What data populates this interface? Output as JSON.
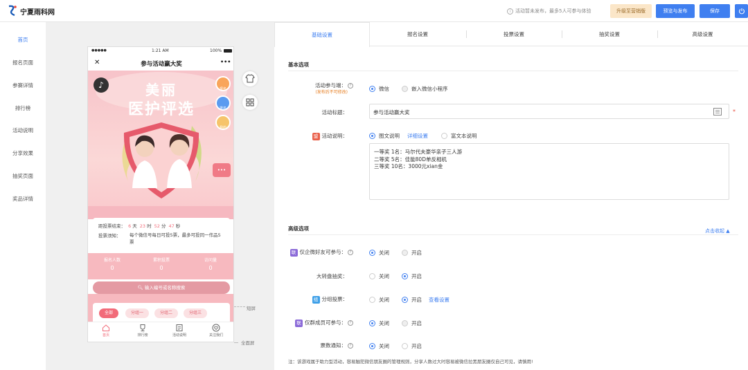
{
  "app": {
    "logo_text": "宁夏雨科网"
  },
  "topbar": {
    "notice": "活动暂未发布，最多5人可参与体验",
    "upgrade": "升级至营销版",
    "preview_publish": "预览与发布",
    "save": "保存"
  },
  "sidenav": {
    "items": [
      "首页",
      "报名页面",
      "参赛详情",
      "排行榜",
      "活动说明",
      "分享效果",
      "抽奖页面",
      "奖品详情"
    ]
  },
  "collapse_glyph": "«",
  "phone": {
    "status": {
      "carrier": "●●●●●",
      "time": "1:21 AM",
      "battery": "100%"
    },
    "close": "✕",
    "title": "参与活动赢大奖",
    "more": "•••",
    "hero": {
      "title_line1": "美丽",
      "title_line2": "医护评选",
      "badges": [
        "报名",
        "排名",
        "我的"
      ],
      "more": "•••"
    },
    "countdown": {
      "label": "距投票结束：",
      "days": "6",
      "days_unit": "天",
      "hours": "23",
      "hours_unit": "时",
      "minutes": "52",
      "minutes_unit": "分",
      "seconds": "47",
      "seconds_unit": "秒",
      "rule_label": "投票须知：",
      "rule_text": "每个微信号每日可投5票，最多可投同一作品5票"
    },
    "stats": [
      {
        "label": "报名人数",
        "value": "0"
      },
      {
        "label": "累积投票",
        "value": "0"
      },
      {
        "label": "访问量",
        "value": "0"
      }
    ],
    "search_placeholder": "输入编号或名称搜索",
    "groups": [
      "全部",
      "分组一",
      "分组二",
      "分组三"
    ],
    "tabbar": [
      "首页",
      "排行榜",
      "活动说明",
      "关注我们"
    ]
  },
  "canvas_labels": {
    "short": "短屏",
    "full": "全面屏"
  },
  "panel": {
    "tabs": [
      "基础设置",
      "报名设置",
      "投票设置",
      "抽奖设置",
      "高级设置"
    ],
    "basic_section": "基本选项",
    "participation_label": "活动参与端：",
    "participation_sub": "(发布后不可修改)",
    "participation_options": [
      "微信",
      "嵌入微信小程序"
    ],
    "title_label": "活动标题：",
    "title_value": "参与活动赢大奖",
    "required_mark": "*",
    "desc_tag": "盟",
    "desc_label": "活动说明：",
    "desc_options": [
      "图文说明",
      "详细设置",
      "富文本说明"
    ],
    "desc_lines": [
      "一等奖 1名：马尔代夫豪华亲子三人游",
      "二等奖 5名：佳能80D单反相机",
      "三等奖 10名：3000元xian金"
    ],
    "advanced_section": "高级选项",
    "fold_link": "点击收起",
    "rows": [
      {
        "tag": "联",
        "label": "仅企微好友可参与：",
        "off": "关闭",
        "on": "开启",
        "selected": "off"
      },
      {
        "tag": "",
        "label": "大转盘抽奖：",
        "off": "关闭",
        "on": "开启",
        "selected": "on"
      },
      {
        "tag": "组",
        "label": "分组投票：",
        "off": "关闭",
        "on": "开启",
        "selected": "on",
        "extra": "查看设置"
      },
      {
        "tag": "联",
        "label": "仅群成员可参与：",
        "off": "关闭",
        "on": "开启",
        "selected": "off"
      },
      {
        "tag": "",
        "label": "票数通知：",
        "off": "关闭",
        "on": "开启",
        "selected": "off"
      }
    ],
    "note": "注：该游戏属于助力型活动，容易触犯微信朋友圈的管理规则，分享人数过大时容易被微信拉黑朋友圈仅自己可见，请慎用!"
  },
  "colors": {
    "accent": "#3f7ff0",
    "pink": "#f26b79",
    "upgrade_bg": "#fbe6c8"
  }
}
